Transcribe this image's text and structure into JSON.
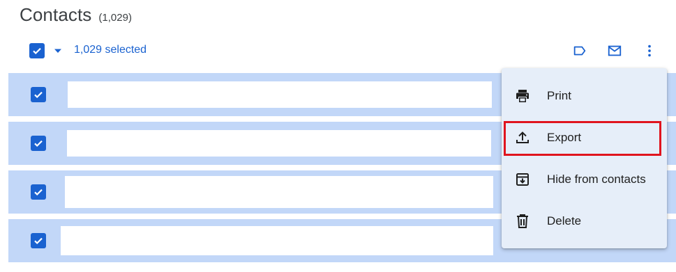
{
  "header": {
    "title": "Contacts",
    "count": "(1,029)"
  },
  "toolbar": {
    "selected_label": "1,029 selected",
    "icons": [
      "checkbox-icon",
      "chevron-down-icon",
      "label-icon",
      "mail-icon",
      "more-vert-icon"
    ]
  },
  "rows": [
    {
      "checked": true
    },
    {
      "checked": true
    },
    {
      "checked": true
    },
    {
      "checked": true
    }
  ],
  "menu": {
    "items": [
      {
        "label": "Print",
        "icon": "print-icon"
      },
      {
        "label": "Export",
        "icon": "export-icon"
      },
      {
        "label": "Hide from contacts",
        "icon": "archive-icon"
      },
      {
        "label": "Delete",
        "icon": "trash-icon"
      }
    ],
    "highlighted": "Export"
  },
  "colors": {
    "accent": "#1a62d0",
    "row_selected": "#c2d7f8",
    "menu_bg": "#e6eef9",
    "highlight": "#e0141e"
  }
}
